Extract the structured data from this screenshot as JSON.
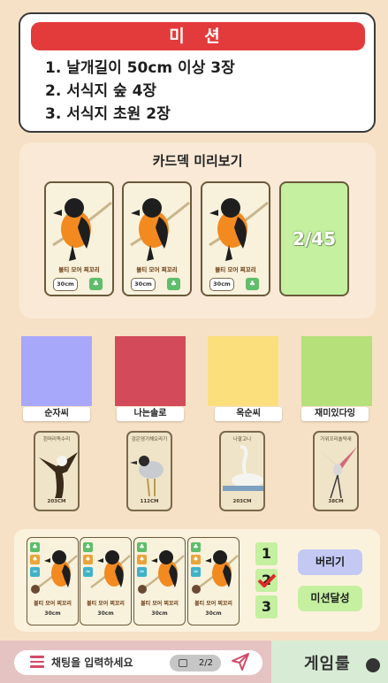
{
  "mission": {
    "title": "미 션",
    "items": [
      "1. 날개길이 50cm 이상 3장",
      "2. 서식지 숲 4장",
      "3. 서식지 초원 2장"
    ]
  },
  "deck": {
    "title": "카드덱 미리보기",
    "cards": [
      {
        "name": "볼티 모어 찌꼬리",
        "size": "30cm",
        "icon": "forest-icon"
      },
      {
        "name": "볼티 모어 찌꼬리",
        "size": "30cm",
        "icon": "forest-icon"
      },
      {
        "name": "볼티 모어 찌꼬리",
        "size": "30cm",
        "icon": "forest-icon"
      }
    ],
    "count": "2/45"
  },
  "players": [
    {
      "name": "순자씨",
      "color": "#a8a8fb",
      "card": {
        "name": "흰머리독수리",
        "size": "203CM"
      }
    },
    {
      "name": "나는솔로",
      "color": "#d34a5b",
      "card": {
        "name": "검은댕기해오라기",
        "size": "112CM"
      }
    },
    {
      "name": "옥순씨",
      "color": "#fbdf7d",
      "card": {
        "name": "나팔고니",
        "size": "203CM"
      }
    },
    {
      "name": "재미있다잉",
      "color": "#b5e07a",
      "card": {
        "name": "가위꼬리솔딱새",
        "size": "38CM"
      }
    }
  ],
  "hand": {
    "cards": [
      {
        "name": "볼티 모어 찌꼬리",
        "size": "30cm"
      },
      {
        "name": "볼티 모어 찌꼬리",
        "size": "30cm"
      },
      {
        "name": "볼티 모어 찌꼬리",
        "size": "30cm"
      },
      {
        "name": "볼티 모어 찌꼬리",
        "size": "30cm"
      }
    ],
    "mission_numbers": [
      "1",
      "2",
      "3"
    ],
    "discard_label": "버리기",
    "complete_label": "미션달성"
  },
  "chat": {
    "placeholder": "채팅을 입력하세요",
    "page": "2/2"
  },
  "rules": {
    "label": "게임룰"
  },
  "colors": {
    "background": "#f6e1c6",
    "mission_red": "#e33b3b",
    "green": "#c4f0a0",
    "discard": "#c3c9f3",
    "complete": "#c4f0a0"
  }
}
